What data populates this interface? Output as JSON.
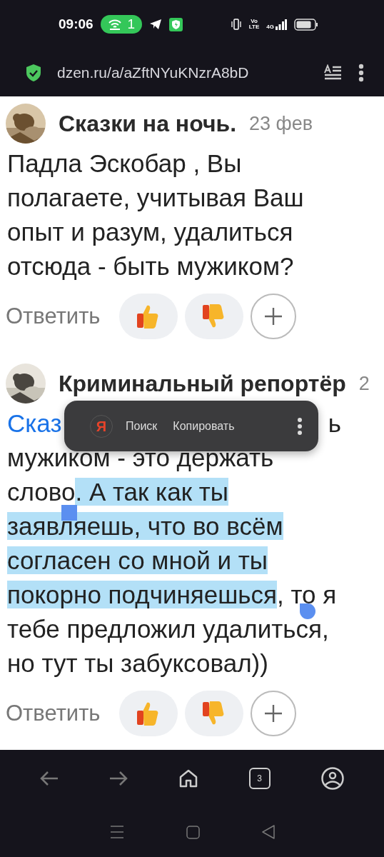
{
  "status_bar": {
    "time": "09:06",
    "hotspot_count": "1",
    "volte_top": "Vo",
    "volte_bottom": "LTE",
    "network": "4G"
  },
  "address_bar": {
    "url": "dzen.ru/a/aZftNYuKNzrA8bD"
  },
  "comments": [
    {
      "author": "Сказки на ночь.",
      "date": "23 фев",
      "segments": [
        {
          "text": "Падла Эскобар , Вы полагаете, учитывая Ваш опыт и разум, удалиться отсюда - быть мужиком?",
          "selected": false
        }
      ],
      "reply": "Ответить"
    },
    {
      "author": "Криминальный репортёр",
      "date": "2",
      "link": "Сказ",
      "first_line_tail": "ь",
      "segments": [
        {
          "text": "мужиком - это держать слово",
          "selected": false
        },
        {
          "text": ". А так как ты заявляешь, что во всём согласен со мной и ты покорно подчиняешься",
          "selected": true
        },
        {
          "text": ", то я тебе предложил удалиться, но тут ты забуксовал))",
          "selected": false
        }
      ],
      "reply": "Ответить"
    }
  ],
  "selection_menu": {
    "logo": "Я",
    "items": [
      "Поиск",
      "Копировать"
    ]
  },
  "bottom_nav": {
    "tab_count": "3"
  }
}
